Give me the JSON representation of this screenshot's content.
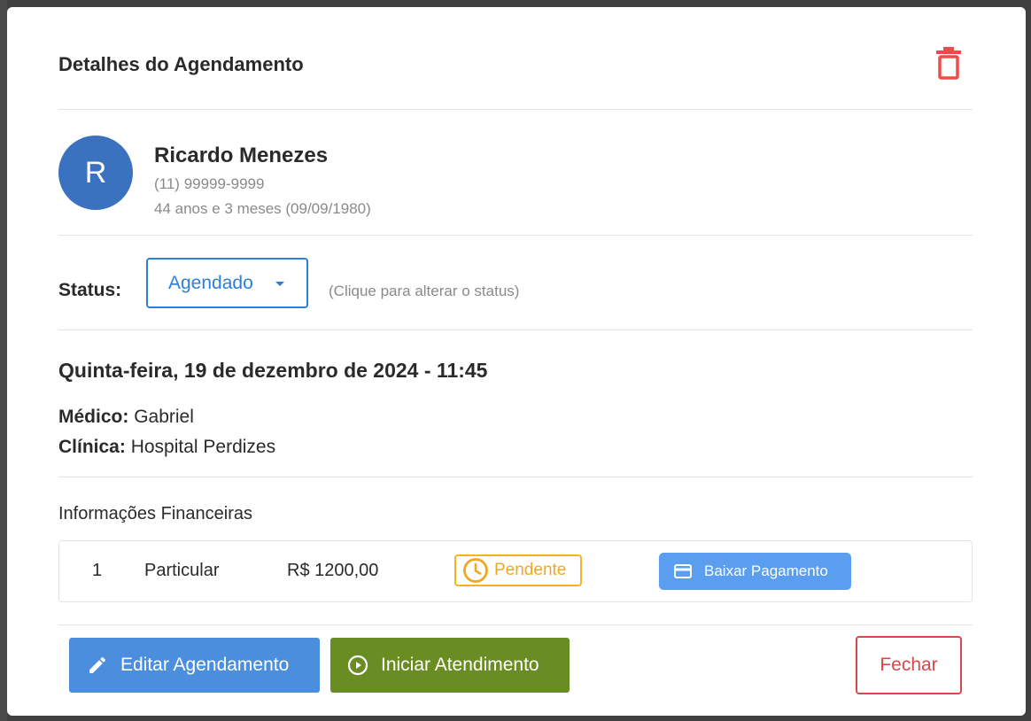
{
  "modal": {
    "title": "Detalhes do Agendamento"
  },
  "patient": {
    "initial": "R",
    "name": "Ricardo Menezes",
    "phone": "(11) 99999-9999",
    "age": "44 anos e 3 meses (09/09/1980)"
  },
  "status": {
    "label": "Status:",
    "value": "Agendado",
    "hint": "(Clique para alterar o status)"
  },
  "appointment": {
    "datetime": "Quinta-feira, 19 de dezembro de 2024 - 11:45",
    "doctor_label": "Médico:",
    "doctor": "Gabriel",
    "clinic_label": "Clínica:",
    "clinic": "Hospital Perdizes"
  },
  "financial": {
    "title": "Informações Financeiras",
    "rows": [
      {
        "index": "1",
        "type": "Particular",
        "amount": "R$ 1200,00",
        "status": "Pendente",
        "action": "Baixar Pagamento"
      }
    ]
  },
  "footer": {
    "edit_label": "Editar Agendamento",
    "start_label": "Iniciar Atendimento",
    "close_label": "Fechar"
  },
  "colors": {
    "primary": "#4c8ede",
    "success": "#6a8d23",
    "danger": "#d94848",
    "warning": "#f5b31f",
    "avatar": "#3a72bf"
  },
  "icons": {
    "delete": "trash-icon",
    "status_caret": "caret-down-icon",
    "pending": "clock-icon",
    "payment": "credit-card-icon",
    "edit": "pencil-icon",
    "start": "play-circle-icon"
  }
}
